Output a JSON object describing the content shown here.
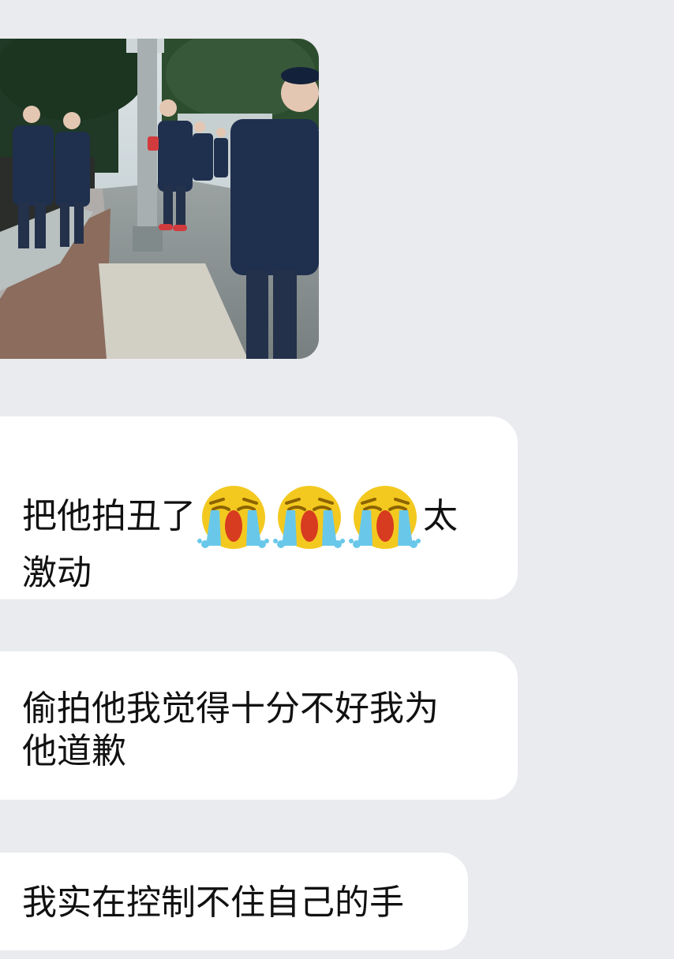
{
  "chat": {
    "image_message": {
      "label": "photo-message",
      "icon": "photo-icon"
    },
    "messages": [
      {
        "line1_before": "把他拍丑了",
        "line1_after": "太",
        "line2": "激动",
        "emoji_count": 3,
        "emoji_name": "loudly-crying-face-icon"
      },
      {
        "line1": "偷拍他我觉得十分不好我为",
        "line2": "他道歉"
      },
      {
        "line1": "我实在控制不住自己的手"
      }
    ]
  },
  "theme": {
    "background": "#e9ebee",
    "bubble": "#ffffff",
    "text": "#111111",
    "emoji_yellow": "#f3c91f",
    "emoji_tear": "#69c8ea",
    "emoji_mouth": "#d73b20"
  }
}
